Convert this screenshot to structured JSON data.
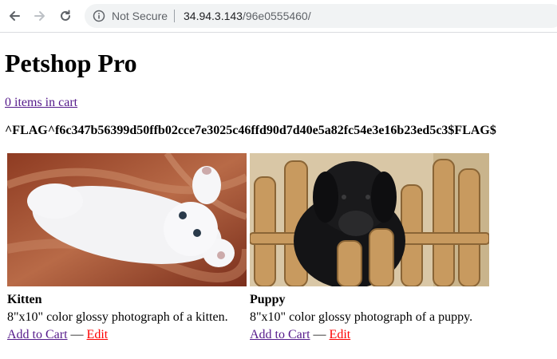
{
  "browser": {
    "security_label": "Not Secure",
    "url_host": "34.94.3.143",
    "url_path": "/96e0555460/"
  },
  "page": {
    "title": "Petshop Pro",
    "cart_link": "0 items in cart",
    "flag": "^FLAG^f6c347b56399d50ffb02cce7e3025c46ffd90d7d40e5a82fc54e3e16b23ed5c3$FLAG$"
  },
  "products": [
    {
      "name": "Kitten",
      "description": "8\"x10\" color glossy photograph of a kitten.",
      "add_label": "Add to Cart",
      "separator": "—",
      "edit_label": "Edit"
    },
    {
      "name": "Puppy",
      "description": "8\"x10\" color glossy photograph of a puppy.",
      "add_label": "Add to Cart",
      "separator": "—",
      "edit_label": "Edit"
    }
  ],
  "colors": {
    "link_visited": "#551a8b",
    "edit_link": "#ff0000"
  }
}
